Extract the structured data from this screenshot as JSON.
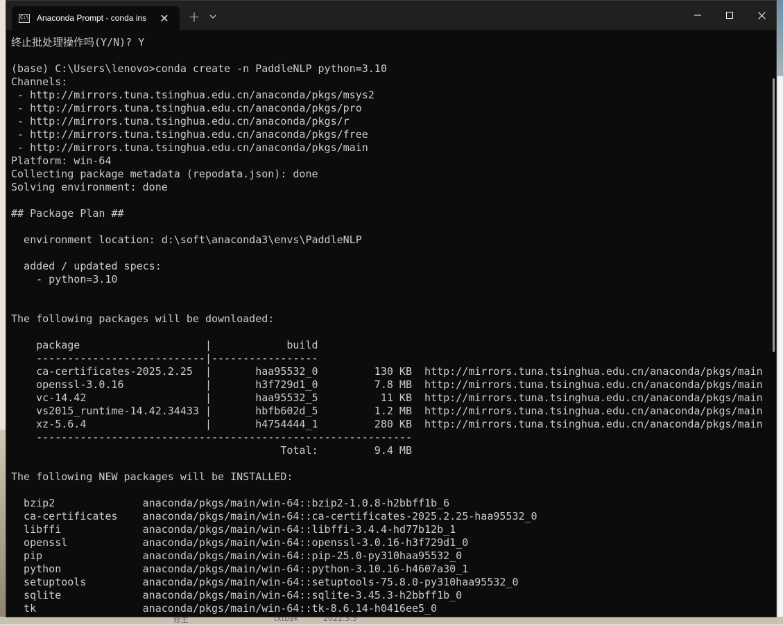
{
  "window": {
    "tab_title": "Anaconda Prompt - conda  ins",
    "tab_close": "✕",
    "new_tab": "+"
  },
  "icons": {
    "app": "terminal-icon",
    "close_tab": "close-icon",
    "new_tab": "plus-icon",
    "dropdown": "chevron-down-icon",
    "minimize": "minimize-icon",
    "maximize": "maximize-icon",
    "close_window": "close-icon"
  },
  "colors": {
    "terminal_bg": "#0c0c0c",
    "terminal_fg": "#cccccc",
    "titlebar_bg": "#202020"
  },
  "background": {
    "bottom_left": "修生",
    "bottom_mid": "txtbak",
    "bottom_date": "2022.5.5"
  },
  "terminal": {
    "lines": [
      "终止批处理操作吗(Y/N)? Y",
      "",
      "(base) C:\\Users\\lenovo>conda create -n PaddleNLP python=3.10",
      "Channels:",
      " - http://mirrors.tuna.tsinghua.edu.cn/anaconda/pkgs/msys2",
      " - http://mirrors.tuna.tsinghua.edu.cn/anaconda/pkgs/pro",
      " - http://mirrors.tuna.tsinghua.edu.cn/anaconda/pkgs/r",
      " - http://mirrors.tuna.tsinghua.edu.cn/anaconda/pkgs/free",
      " - http://mirrors.tuna.tsinghua.edu.cn/anaconda/pkgs/main",
      "Platform: win-64",
      "Collecting package metadata (repodata.json): done",
      "Solving environment: done",
      "",
      "## Package Plan ##",
      "",
      "  environment location: d:\\soft\\anaconda3\\envs\\PaddleNLP",
      "",
      "  added / updated specs:",
      "    - python=3.10",
      "",
      "",
      "The following packages will be downloaded:",
      "",
      "    package                    |            build",
      "    ---------------------------|-----------------",
      "    ca-certificates-2025.2.25  |       haa95532_0         130 KB  http://mirrors.tuna.tsinghua.edu.cn/anaconda/pkgs/main",
      "    openssl-3.0.16             |       h3f729d1_0         7.8 MB  http://mirrors.tuna.tsinghua.edu.cn/anaconda/pkgs/main",
      "    vc-14.42                   |       haa95532_5          11 KB  http://mirrors.tuna.tsinghua.edu.cn/anaconda/pkgs/main",
      "    vs2015_runtime-14.42.34433 |       hbfb602d_5         1.2 MB  http://mirrors.tuna.tsinghua.edu.cn/anaconda/pkgs/main",
      "    xz-5.6.4                   |       h4754444_1         280 KB  http://mirrors.tuna.tsinghua.edu.cn/anaconda/pkgs/main",
      "    ------------------------------------------------------------",
      "                                           Total:         9.4 MB",
      "",
      "The following NEW packages will be INSTALLED:",
      "",
      "  bzip2              anaconda/pkgs/main/win-64::bzip2-1.0.8-h2bbff1b_6",
      "  ca-certificates    anaconda/pkgs/main/win-64::ca-certificates-2025.2.25-haa95532_0",
      "  libffi             anaconda/pkgs/main/win-64::libffi-3.4.4-hd77b12b_1",
      "  openssl            anaconda/pkgs/main/win-64::openssl-3.0.16-h3f729d1_0",
      "  pip                anaconda/pkgs/main/win-64::pip-25.0-py310haa95532_0",
      "  python             anaconda/pkgs/main/win-64::python-3.10.16-h4607a30_1",
      "  setuptools         anaconda/pkgs/main/win-64::setuptools-75.8.0-py310haa95532_0",
      "  sqlite             anaconda/pkgs/main/win-64::sqlite-3.45.3-h2bbff1b_0",
      "  tk                 anaconda/pkgs/main/win-64::tk-8.6.14-h0416ee5_0"
    ]
  }
}
